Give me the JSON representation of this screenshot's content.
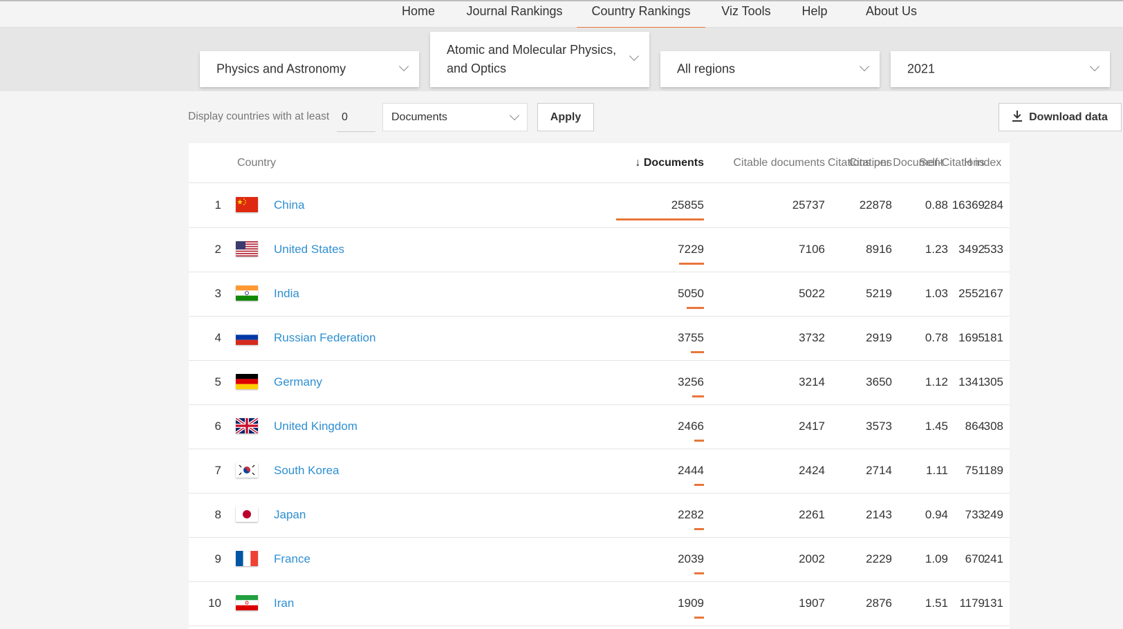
{
  "nav": {
    "items": [
      {
        "label": "Home"
      },
      {
        "label": "Journal Rankings"
      },
      {
        "label": "Country Rankings"
      },
      {
        "label": "Viz Tools"
      },
      {
        "label": "Help"
      },
      {
        "label": "About Us"
      }
    ],
    "active": "Country Rankings"
  },
  "filters": {
    "area": "Physics and Astronomy",
    "category_line1": "Atomic and Molecular Physics,",
    "category_line2": "and Optics",
    "region": "All regions",
    "year": "2021"
  },
  "controls": {
    "display_label": "Display countries with at least",
    "min_value": "0",
    "metric": "Documents",
    "apply_label": "Apply",
    "download_label": "Download data"
  },
  "table": {
    "headers": {
      "country": "Country",
      "documents": "Documents",
      "citable": "Citable documents",
      "citations": "Citations",
      "self_citations": "Self-Citations",
      "cpd": "Citations per Document",
      "h_index": "H index"
    },
    "rows": [
      {
        "rank": "1",
        "country": "China",
        "flag": "cn",
        "documents": "25855",
        "citable": "25737",
        "citations": "22878",
        "self_citations": "16369",
        "cpd": "0.88",
        "h_index": "284",
        "share": 1.0
      },
      {
        "rank": "2",
        "country": "United States",
        "flag": "us",
        "documents": "7229",
        "citable": "7106",
        "citations": "8916",
        "self_citations": "3492",
        "cpd": "1.23",
        "h_index": "533",
        "share": 0.28
      },
      {
        "rank": "3",
        "country": "India",
        "flag": "in",
        "documents": "5050",
        "citable": "5022",
        "citations": "5219",
        "self_citations": "2552",
        "cpd": "1.03",
        "h_index": "167",
        "share": 0.2
      },
      {
        "rank": "4",
        "country": "Russian Federation",
        "flag": "ru",
        "documents": "3755",
        "citable": "3732",
        "citations": "2919",
        "self_citations": "1695",
        "cpd": "0.78",
        "h_index": "181",
        "share": 0.15
      },
      {
        "rank": "5",
        "country": "Germany",
        "flag": "de",
        "documents": "3256",
        "citable": "3214",
        "citations": "3650",
        "self_citations": "1341",
        "cpd": "1.12",
        "h_index": "305",
        "share": 0.13
      },
      {
        "rank": "6",
        "country": "United Kingdom",
        "flag": "gb",
        "documents": "2466",
        "citable": "2417",
        "citations": "3573",
        "self_citations": "864",
        "cpd": "1.45",
        "h_index": "308",
        "share": 0.1
      },
      {
        "rank": "7",
        "country": "South Korea",
        "flag": "kr",
        "documents": "2444",
        "citable": "2424",
        "citations": "2714",
        "self_citations": "751",
        "cpd": "1.11",
        "h_index": "189",
        "share": 0.1
      },
      {
        "rank": "8",
        "country": "Japan",
        "flag": "jp",
        "documents": "2282",
        "citable": "2261",
        "citations": "2143",
        "self_citations": "733",
        "cpd": "0.94",
        "h_index": "249",
        "share": 0.09
      },
      {
        "rank": "9",
        "country": "France",
        "flag": "fr",
        "documents": "2039",
        "citable": "2002",
        "citations": "2229",
        "self_citations": "670",
        "cpd": "1.09",
        "h_index": "241",
        "share": 0.08
      },
      {
        "rank": "10",
        "country": "Iran",
        "flag": "ir",
        "documents": "1909",
        "citable": "1907",
        "citations": "2876",
        "self_citations": "1179",
        "cpd": "1.51",
        "h_index": "131",
        "share": 0.08
      }
    ]
  },
  "colors": {
    "accent": "#e8763a",
    "link": "#2e8fd1"
  }
}
